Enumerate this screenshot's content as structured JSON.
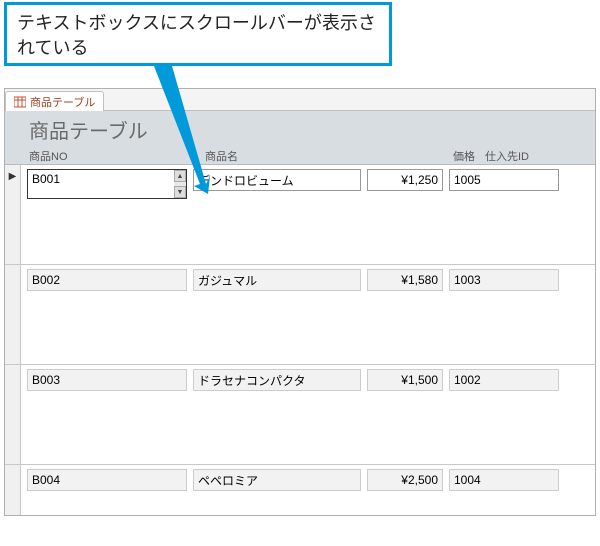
{
  "callout": {
    "text": "テキストボックスにスクロールバーが表示されている"
  },
  "tab": {
    "label": "商品テーブル"
  },
  "form": {
    "title": "商品テーブル"
  },
  "columns": {
    "no": "商品NO",
    "name": "商品名",
    "price": "価格",
    "supplier": "仕入先ID"
  },
  "rows": [
    {
      "no": "B001",
      "name": "デンドロビューム",
      "price": "¥1,250",
      "supplier": "1005",
      "current": true
    },
    {
      "no": "B002",
      "name": "ガジュマル",
      "price": "¥1,580",
      "supplier": "1003",
      "current": false
    },
    {
      "no": "B003",
      "name": "ドラセナコンパクタ",
      "price": "¥1,500",
      "supplier": "1002",
      "current": false
    },
    {
      "no": "B004",
      "name": "ペペロミア",
      "price": "¥2,500",
      "supplier": "1004",
      "current": false
    }
  ],
  "icons": {
    "tab": "table-icon",
    "current_marker": "▶"
  }
}
